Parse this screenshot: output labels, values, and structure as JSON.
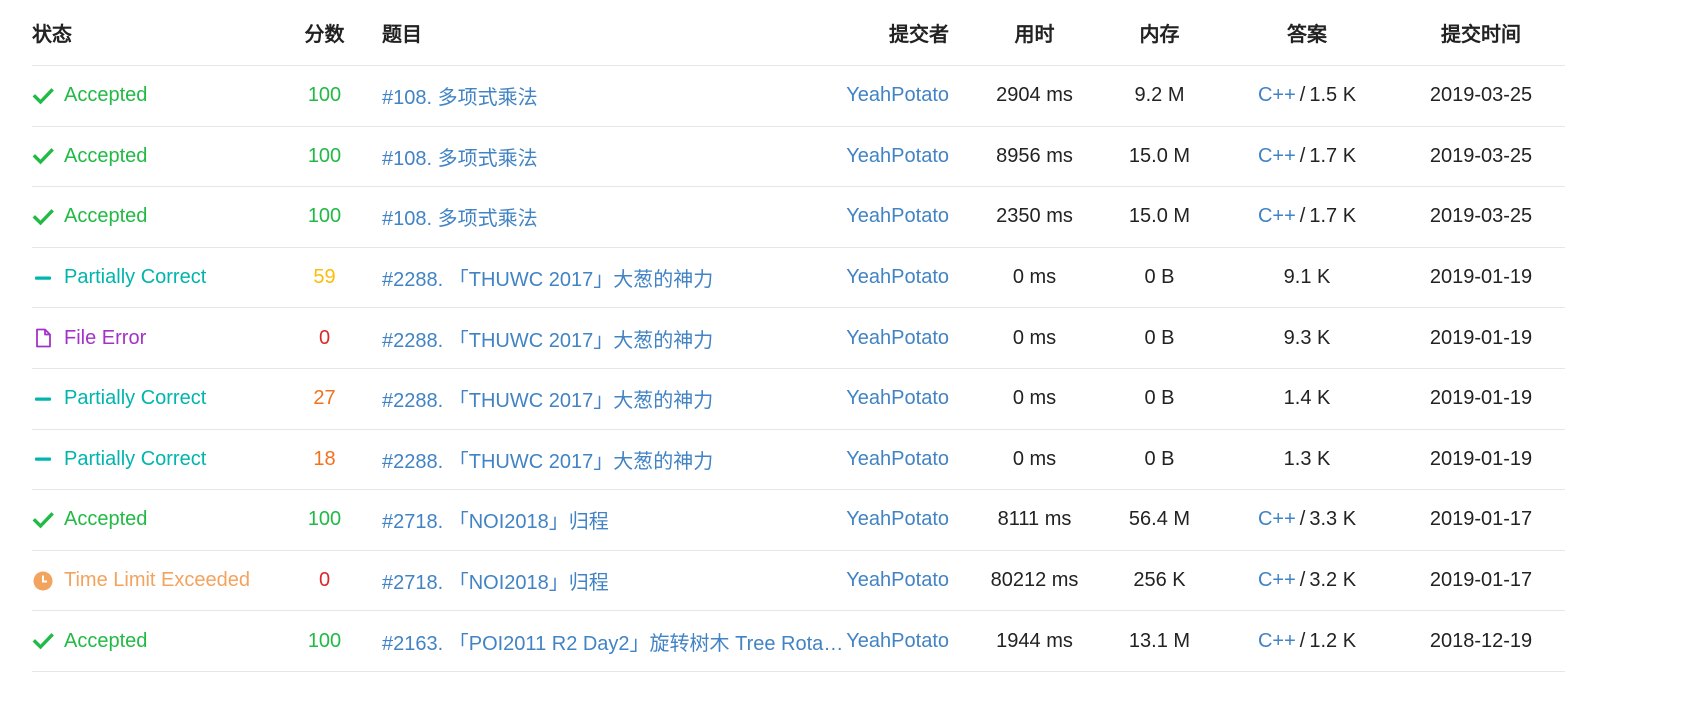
{
  "headers": {
    "status": "状态",
    "score": "分数",
    "problem": "题目",
    "submitter": "提交者",
    "time": "用时",
    "memory": "内存",
    "answer": "答案",
    "submit_time": "提交时间"
  },
  "colors": {
    "accepted": "#21ba45",
    "partial": "#00b5ad",
    "file_error": "#a333c8",
    "tle": "#f2a35e",
    "score_full": "#21ba45",
    "score_mid": "#fbbd08",
    "score_low": "#f2711c",
    "score_zero": "#db2828",
    "link": "#4183c4"
  },
  "rows": [
    {
      "status": "Accepted",
      "status_icon": "check-icon",
      "score": "100",
      "problem": "#108. 多项式乘法",
      "user": "YeahPotato",
      "time": "2904 ms",
      "memory": "9.2 M",
      "lang": "C++",
      "size": "1.5 K",
      "date": "2019-03-25"
    },
    {
      "status": "Accepted",
      "status_icon": "check-icon",
      "score": "100",
      "problem": "#108. 多项式乘法",
      "user": "YeahPotato",
      "time": "8956 ms",
      "memory": "15.0 M",
      "lang": "C++",
      "size": "1.7 K",
      "date": "2019-03-25"
    },
    {
      "status": "Accepted",
      "status_icon": "check-icon",
      "score": "100",
      "problem": "#108. 多项式乘法",
      "user": "YeahPotato",
      "time": "2350 ms",
      "memory": "15.0 M",
      "lang": "C++",
      "size": "1.7 K",
      "date": "2019-03-25"
    },
    {
      "status": "Partially Correct",
      "status_icon": "minus-icon",
      "score": "59",
      "problem": "#2288. 「THUWC 2017」大葱的神力",
      "user": "YeahPotato",
      "time": "0 ms",
      "memory": "0 B",
      "lang": "",
      "size": "9.1 K",
      "date": "2019-01-19"
    },
    {
      "status": "File Error",
      "status_icon": "file-icon",
      "score": "0",
      "problem": "#2288. 「THUWC 2017」大葱的神力",
      "user": "YeahPotato",
      "time": "0 ms",
      "memory": "0 B",
      "lang": "",
      "size": "9.3 K",
      "date": "2019-01-19"
    },
    {
      "status": "Partially Correct",
      "status_icon": "minus-icon",
      "score": "27",
      "problem": "#2288. 「THUWC 2017」大葱的神力",
      "user": "YeahPotato",
      "time": "0 ms",
      "memory": "0 B",
      "lang": "",
      "size": "1.4 K",
      "date": "2019-01-19"
    },
    {
      "status": "Partially Correct",
      "status_icon": "minus-icon",
      "score": "18",
      "problem": "#2288. 「THUWC 2017」大葱的神力",
      "user": "YeahPotato",
      "time": "0 ms",
      "memory": "0 B",
      "lang": "",
      "size": "1.3 K",
      "date": "2019-01-19"
    },
    {
      "status": "Accepted",
      "status_icon": "check-icon",
      "score": "100",
      "problem": "#2718. 「NOI2018」归程",
      "user": "YeahPotato",
      "time": "8111 ms",
      "memory": "56.4 M",
      "lang": "C++",
      "size": "3.3 K",
      "date": "2019-01-17"
    },
    {
      "status": "Time Limit Exceeded",
      "status_icon": "clock-icon",
      "score": "0",
      "problem": "#2718. 「NOI2018」归程",
      "user": "YeahPotato",
      "time": "80212 ms",
      "memory": "256 K",
      "lang": "C++",
      "size": "3.2 K",
      "date": "2019-01-17"
    },
    {
      "status": "Accepted",
      "status_icon": "check-icon",
      "score": "100",
      "problem": "#2163. 「POI2011 R2 Day2」旋转树木 Tree Rotatio…",
      "user": "YeahPotato",
      "time": "1944 ms",
      "memory": "13.1 M",
      "lang": "C++",
      "size": "1.2 K",
      "date": "2018-12-19"
    }
  ]
}
